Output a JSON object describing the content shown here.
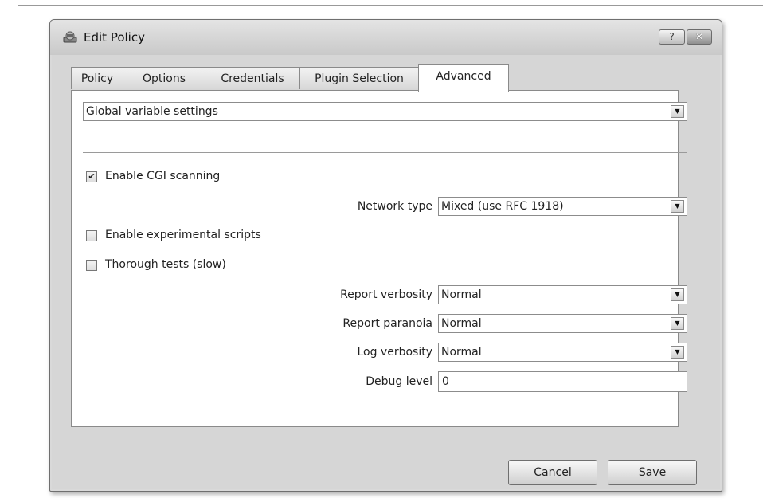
{
  "window": {
    "title": "Edit Policy",
    "help_label": "?",
    "close_label": "✕"
  },
  "tabs": [
    {
      "label": "Policy",
      "active": false
    },
    {
      "label": "Options",
      "active": false
    },
    {
      "label": "Credentials",
      "active": false
    },
    {
      "label": "Plugin Selection",
      "active": false
    },
    {
      "label": "Advanced",
      "active": true
    }
  ],
  "advanced": {
    "section_select": "Global variable settings",
    "enable_cgi": {
      "label": "Enable CGI scanning",
      "checked": true
    },
    "network_type": {
      "label": "Network type",
      "value": "Mixed (use RFC 1918)"
    },
    "experimental": {
      "label": "Enable experimental scripts",
      "checked": false
    },
    "thorough": {
      "label": "Thorough tests (slow)",
      "checked": false
    },
    "report_verbosity": {
      "label": "Report verbosity",
      "value": "Normal"
    },
    "report_paranoia": {
      "label": "Report paranoia",
      "value": "Normal"
    },
    "log_verbosity": {
      "label": "Log verbosity",
      "value": "Normal"
    },
    "debug_level": {
      "label": "Debug level",
      "value": "0"
    }
  },
  "buttons": {
    "cancel": "Cancel",
    "save": "Save"
  },
  "icons": {
    "dropdown": "chevron-down-icon",
    "check": "checkmark-icon",
    "app": "policy-app-icon"
  },
  "colors": {
    "window_bg": "#d9d9d9",
    "panel_bg": "#ffffff",
    "border": "#8a8a8a"
  }
}
